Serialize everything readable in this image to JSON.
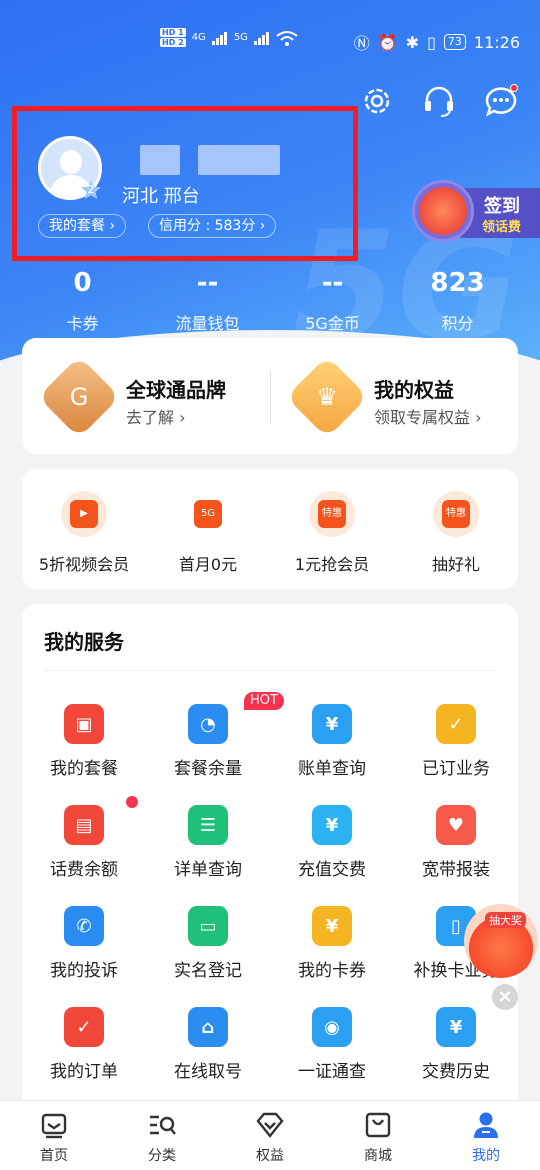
{
  "status_bar": {
    "hd1": "HD 1",
    "hd2": "HD 2",
    "net1": "4G",
    "net2": "5G",
    "battery": "73",
    "time": "11:26"
  },
  "profile": {
    "location": "河北  邢台",
    "avatar_badge": "2",
    "plan_pill": "我的套餐 ›",
    "credit_pill": "信用分 :  583分 ›"
  },
  "signin": {
    "title": "签到",
    "subtitle": "领话费"
  },
  "stats": [
    {
      "value": "0",
      "label": "卡券"
    },
    {
      "value": "--",
      "label": "流量钱包"
    },
    {
      "value": "--",
      "label": "5G金币"
    },
    {
      "value": "823",
      "label": "积分"
    }
  ],
  "brand": {
    "left_title": "全球通品牌",
    "left_sub": "去了解 ›",
    "right_title": "我的权益",
    "right_sub": "领取专属权益 ›"
  },
  "promos": [
    {
      "label": "5折视频会员",
      "tag": "▶"
    },
    {
      "label": "首月0元",
      "tag": "5G"
    },
    {
      "label": "1元抢会员",
      "tag": "特惠"
    },
    {
      "label": "抽好礼",
      "tag": "特惠"
    }
  ],
  "services": {
    "title": "我的服务",
    "hot_badge": "HOT",
    "items": [
      {
        "label": "我的套餐",
        "color": "#f2483a",
        "glyph": "▣"
      },
      {
        "label": "套餐余量",
        "color": "#2b8df2",
        "glyph": "◔"
      },
      {
        "label": "账单查询",
        "color": "#2b9ff2",
        "glyph": "¥"
      },
      {
        "label": "已订业务",
        "color": "#f5b522",
        "glyph": "✓"
      },
      {
        "label": "话费余额",
        "color": "#f2483a",
        "glyph": "▤"
      },
      {
        "label": "详单查询",
        "color": "#20c07a",
        "glyph": "☰"
      },
      {
        "label": "充值交费",
        "color": "#2bb2f2",
        "glyph": "¥"
      },
      {
        "label": "宽带报装",
        "color": "#f55a4a",
        "glyph": "♥"
      },
      {
        "label": "我的投诉",
        "color": "#2b8df2",
        "glyph": "✆"
      },
      {
        "label": "实名登记",
        "color": "#20c07a",
        "glyph": "▭"
      },
      {
        "label": "我的卡券",
        "color": "#f5b522",
        "glyph": "¥"
      },
      {
        "label": "补换卡业务",
        "color": "#2b9ff2",
        "glyph": "▯"
      },
      {
        "label": "我的订单",
        "color": "#f2483a",
        "glyph": "✓"
      },
      {
        "label": "在线取号",
        "color": "#2b8df2",
        "glyph": "⌂"
      },
      {
        "label": "一证通查",
        "color": "#2b9ff2",
        "glyph": "◉"
      },
      {
        "label": "交费历史",
        "color": "#2b9ff2",
        "glyph": "¥"
      }
    ]
  },
  "float": {
    "prize_label": "抽大奖",
    "close": "×"
  },
  "tabs": [
    {
      "label": "首页"
    },
    {
      "label": "分类"
    },
    {
      "label": "权益"
    },
    {
      "label": "商城"
    },
    {
      "label": "我的"
    }
  ]
}
